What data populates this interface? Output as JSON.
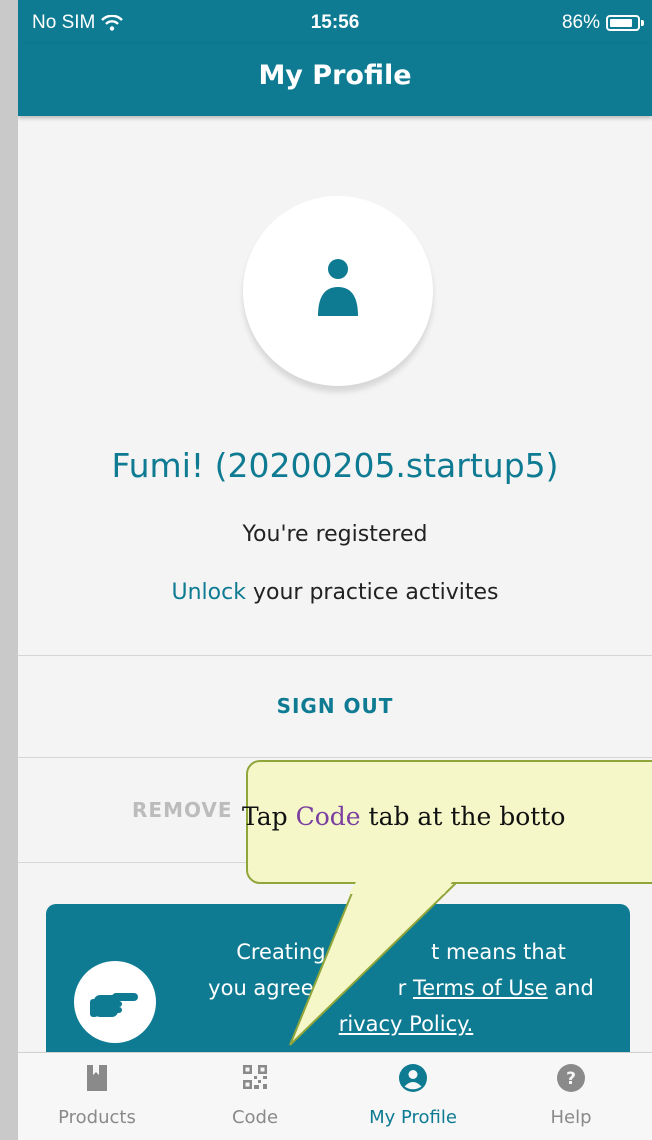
{
  "status_bar": {
    "carrier": "No SIM",
    "time": "15:56",
    "battery": "86%"
  },
  "header": {
    "title": "My Profile"
  },
  "profile": {
    "name": "Fumi! (20200205.startup5)",
    "registered": "You're registered",
    "unlock_link": "Unlock",
    "unlock_rest": " your practice activites"
  },
  "actions": {
    "sign_out": "SIGN OUT",
    "remove": "REMOVE"
  },
  "terms": {
    "part1": "Creating a",
    "part2": "t means that",
    "part3": "you agree",
    "part4": "r ",
    "terms_link": "Terms of Use",
    "part5": " and",
    "privacy_link": "rivacy Policy."
  },
  "tutorial": {
    "prefix": "Tap ",
    "highlight": "Code",
    "suffix": " tab at the botto"
  },
  "tabs": [
    {
      "label": "Products",
      "icon": "book-icon"
    },
    {
      "label": "Code",
      "icon": "qr-code-icon"
    },
    {
      "label": "My Profile",
      "icon": "person-circle-icon"
    },
    {
      "label": "Help",
      "icon": "help-icon"
    }
  ],
  "colors": {
    "brand": "#0e7b93",
    "callout_bg": "#f5f7c9",
    "callout_border": "#8fa53a",
    "highlight": "#7b3fa0"
  }
}
